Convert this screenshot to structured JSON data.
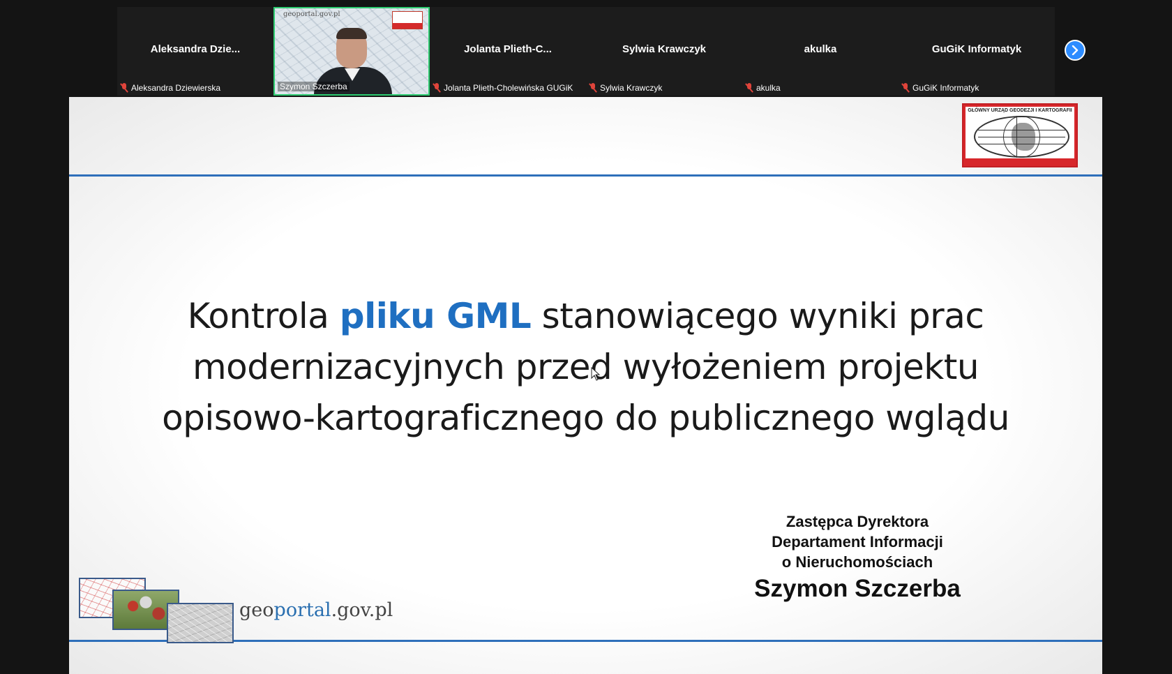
{
  "participants": [
    {
      "display_name": "Aleksandra  Dzie...",
      "label": "Aleksandra Dziewierska",
      "muted": true
    },
    {
      "label": "Szymon Szczerba",
      "video_on": true,
      "video_overlay_text": "geoportal.gov.pl"
    },
    {
      "display_name": "Jolanta  Plieth-C...",
      "label": "Jolanta Plieth-Cholewińska GUGiK",
      "muted": true
    },
    {
      "display_name": "Sylwia Krawczyk",
      "label": "Sylwia Krawczyk",
      "muted": true
    },
    {
      "display_name": "akulka",
      "label": "akulka",
      "muted": true
    },
    {
      "display_name": "GuGiK Informatyk",
      "label": "GuGiK Informatyk",
      "muted": true
    }
  ],
  "next_page_icon": "chevron-right-icon",
  "colors": {
    "accent": "#2d8cff",
    "active_speaker": "#2ecc71",
    "slide_blue": "#2e6fba",
    "title_highlight": "#1f6fc1",
    "muted_red": "#e0443b"
  },
  "slide": {
    "logo_text": "GŁÓWNY URZĄD GEODEZJI I KARTOGRAFII",
    "title_lines": [
      {
        "pre": "Kontrola ",
        "highlight": "pliku GML",
        "post": " stanowiącego wyniki prac"
      },
      {
        "text": "modernizacyjnych przed wyłożeniem projektu"
      },
      {
        "text": "opisowo-kartograficznego do publicznego wglądu"
      }
    ],
    "presenter": {
      "role": "Zastępca Dyrektora",
      "department": "Departament Informacji",
      "department_line2": "o Nieruchomościach",
      "name": "Szymon Szczerba"
    },
    "footer_brand": {
      "prefix": "geo",
      "portal": "portal",
      "suffix": ".gov.pl"
    }
  }
}
